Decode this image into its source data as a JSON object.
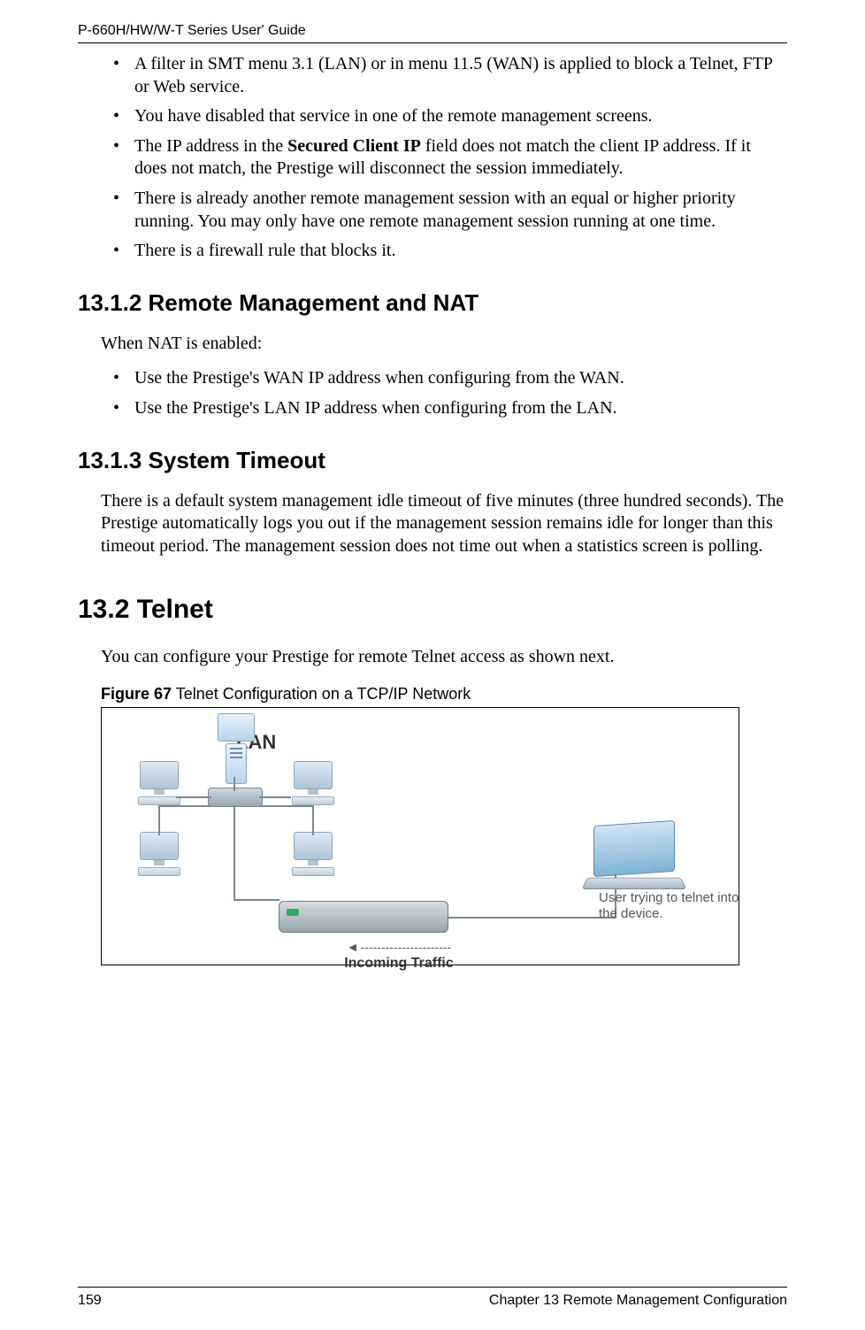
{
  "running_header": "P-660H/HW/W-T Series User' Guide",
  "top_bullets": [
    "A filter in SMT menu 3.1 (LAN) or in menu 11.5 (WAN) is applied to block a Telnet, FTP or Web service.",
    "You have disabled that service in one of the remote management screens.",
    "",
    "There is already another remote management session with an equal or higher priority running. You may only have one remote management session running at one time.",
    "There is a firewall rule that blocks it."
  ],
  "ip_bullet_prefix": "The IP address in the ",
  "ip_bullet_bold": "Secured Client IP",
  "ip_bullet_suffix": " field does not match the client IP address. If it does not match, the Prestige will disconnect the session immediately.",
  "sec_13_1_2": {
    "heading": "13.1.2  Remote Management and NAT",
    "intro": "When NAT is enabled:",
    "bullets": [
      "Use the Prestige's WAN IP address when configuring from the WAN.",
      "Use the Prestige's LAN IP address when configuring from the LAN."
    ]
  },
  "sec_13_1_3": {
    "heading": "13.1.3   System Timeout",
    "para": "There is a default system management idle timeout of five minutes (three hundred seconds). The Prestige automatically logs you out if the management session remains idle for longer than this timeout period. The management session does not time out when a statistics screen is polling."
  },
  "sec_13_2": {
    "heading": "13.2  Telnet",
    "para": "You can configure your Prestige for remote Telnet access as shown next."
  },
  "figure": {
    "label_bold": "Figure 67",
    "caption": "   Telnet Configuration on a TCP/IP Network",
    "lan_label": "LAN",
    "user_note": "User trying to telnet into the device.",
    "incoming_dashes": "----------------------",
    "incoming_label": "Incoming Traffic"
  },
  "footer": {
    "page": "159",
    "chapter": "Chapter 13 Remote Management Configuration"
  }
}
